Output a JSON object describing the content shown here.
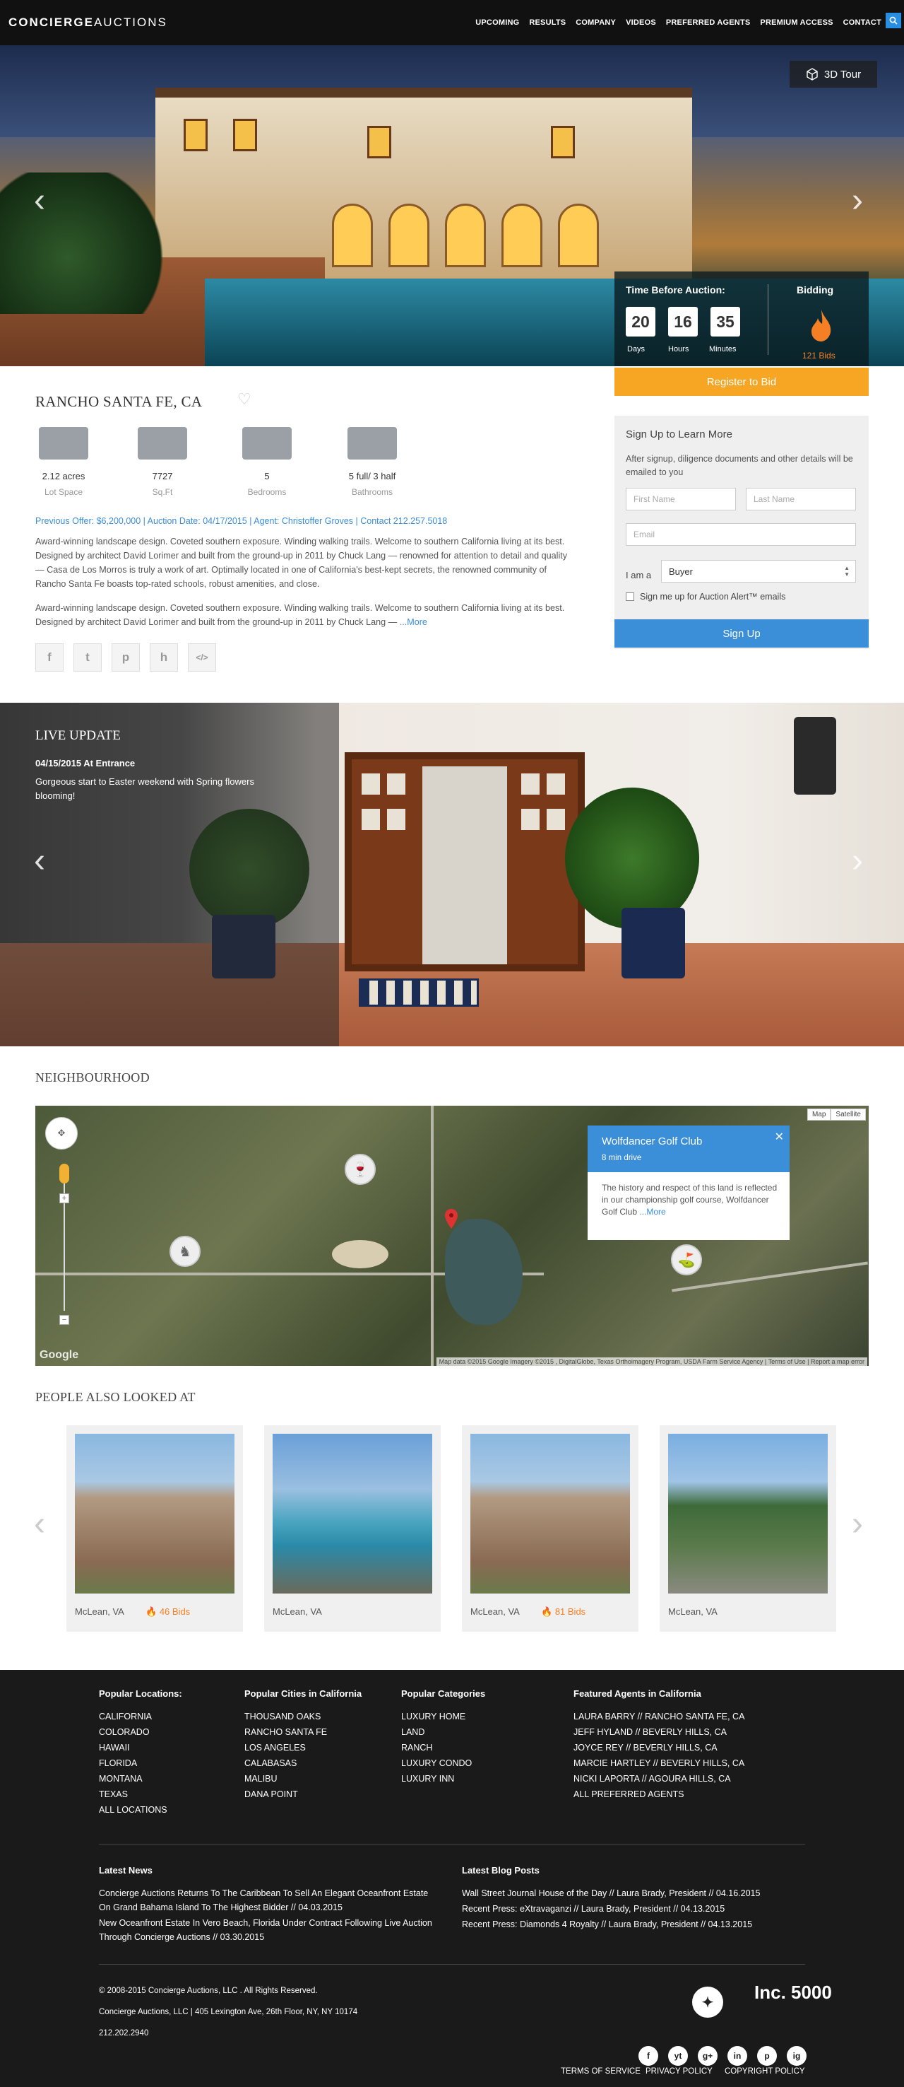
{
  "header": {
    "logo_left": "CONCIERGE",
    "logo_right": "AUCTIONS",
    "nav": [
      "UPCOMING",
      "RESULTS",
      "COMPANY",
      "VIDEOS",
      "PREFERRED AGENTS",
      "PREMIUM ACCESS",
      "CONTACT"
    ],
    "search_icon": "search-icon"
  },
  "hero": {
    "tour_label": "3D Tour",
    "prev_icon": "chevron-left-icon",
    "next_icon": "chevron-right-icon"
  },
  "auction": {
    "time_label": "Time Before Auction:",
    "bidding_label": "Bidding",
    "days": "20",
    "hours": "16",
    "minutes": "35",
    "days_unit": "Days",
    "hours_unit": "Hours",
    "minutes_unit": "Minutes",
    "bids": "121 Bids",
    "register": "Register to Bid"
  },
  "property": {
    "title": "RANCHO SANTA FE, CA",
    "stats": [
      {
        "value": "2.12 acres",
        "label": "Lot Space",
        "icon": "lot-icon"
      },
      {
        "value": "7727",
        "label": "Sq.Ft",
        "icon": "floorplan-icon"
      },
      {
        "value": "5",
        "label": "Bedrooms",
        "icon": "bed-icon"
      },
      {
        "value": "5 full/ 3 half",
        "label": "Bathrooms",
        "icon": "bath-icon"
      }
    ],
    "meta": "Previous Offer: $6,200,000  |  Auction Date: 04/17/2015  |  Agent: Christoffer Groves  |  Contact 212.257.5018",
    "para1": "Award-winning landscape design. Coveted southern exposure. Winding walking trails. Welcome to southern California living at its best. Designed by architect David Lorimer and built from the ground-up in 2011 by Chuck Lang — renowned for attention to detail and quality — Casa de Los Morros is truly a work of art. Optimally located in one of California's best-kept secrets, the renowned community of Rancho Santa Fe boasts top-rated schools, robust amenities, and close.",
    "para2": "Award-winning landscape design. Coveted southern exposure. Winding walking trails. Welcome to southern California living at its best. Designed by architect David Lorimer and built from the ground-up in 2011 by Chuck Lang —",
    "more": "...More",
    "share": [
      "f",
      "t",
      "p",
      "h",
      "</>"
    ]
  },
  "signup": {
    "title": "Sign Up to Learn More",
    "desc": "After signup, diligence documents and other details will be emailed to you",
    "first_name": "First Name",
    "last_name": "Last Name",
    "email": "Email",
    "iam": "I am a",
    "role": "Buyer",
    "alert": "Sign me up for  Auction Alert™ emails",
    "button": "Sign Up"
  },
  "live": {
    "title": "LIVE UPDATE",
    "date": "04/15/2015   At Entrance",
    "text": "Gorgeous start to Easter weekend with Spring flowers blooming!"
  },
  "neighbourhood": {
    "title": "NEIGHBOURHOOD",
    "map_types": [
      "Map",
      "Satellite"
    ],
    "poi_name": "Wolfdancer Golf Club",
    "poi_drive": "8 min drive",
    "poi_desc": "The history and respect of this land is reflected in our championship golf course, Wolfdancer Golf Club",
    "poi_more": "...More",
    "google": "Google",
    "attribution": "Map data ©2015 Google Imagery ©2015 , DigitalGlobe, Texas Orthoimagery Program, USDA Farm Service Agency  |  Terms of Use  |  Report a map error"
  },
  "also": {
    "title": "PEOPLE ALSO LOOKED AT",
    "cards": [
      {
        "location": "McLean, VA",
        "bids": "46 Bids"
      },
      {
        "location": "McLean, VA",
        "bids": ""
      },
      {
        "location": "McLean, VA",
        "bids": "81 Bids"
      },
      {
        "location": "McLean, VA",
        "bids": ""
      }
    ]
  },
  "footer": {
    "cols": [
      {
        "title": "Popular Locations:",
        "items": [
          "CALIFORNIA",
          "COLORADO",
          "HAWAII",
          "FLORIDA",
          "MONTANA",
          "TEXAS",
          "ALL LOCATIONS"
        ]
      },
      {
        "title": "Popular Cities in California",
        "items": [
          "THOUSAND OAKS",
          "RANCHO SANTA FE",
          "LOS ANGELES",
          "CALABASAS",
          "MALIBU",
          "DANA POINT"
        ]
      },
      {
        "title": "Popular Categories",
        "items": [
          "LUXURY HOME",
          "LAND",
          "RANCH",
          "LUXURY CONDO",
          "LUXURY INN"
        ]
      },
      {
        "title": "Featured Agents in California",
        "items": [
          "LAURA BARRY // RANCHO SANTA FE, CA",
          "JEFF HYLAND // BEVERLY HILLS, CA",
          "JOYCE REY // BEVERLY HILLS, CA",
          "MARCIE HARTLEY // BEVERLY HILLS, CA",
          "NICKI LAPORTA // AGOURA HILLS, CA",
          "ALL PREFERRED AGENTS"
        ]
      }
    ],
    "news_title": "Latest News",
    "news": [
      "Concierge Auctions Returns To The Caribbean To Sell An Elegant Oceanfront Estate On Grand Bahama Island To The Highest Bidder // 04.03.2015",
      "New Oceanfront Estate In Vero Beach, Florida Under Contract Following Live Auction Through Concierge Auctions // 03.30.2015"
    ],
    "blog_title": "Latest Blog Posts",
    "blog": [
      "Wall Street Journal House of the Day // Laura Brady, President // 04.16.2015",
      "Recent Press: eXtravaganzi // Laura Brady, President // 04.13.2015",
      "Recent Press: Diamonds 4 Royalty // Laura Brady, President // 04.13.2015"
    ],
    "copyright": "© 2008-2015 Concierge Auctions, LLC . All Rights Reserved.",
    "address": "Concierge Auctions, LLC | 405 Lexington Ave, 26th Floor, NY, NY 10174",
    "phone": "212.202.2940",
    "badge": "Inc. 5000",
    "social": [
      "f",
      "yt",
      "g+",
      "in",
      "p",
      "ig"
    ],
    "links": [
      "TERMS OF SERVICE",
      "PRIVACY POLICY",
      "COPYRIGHT POLICY"
    ]
  }
}
